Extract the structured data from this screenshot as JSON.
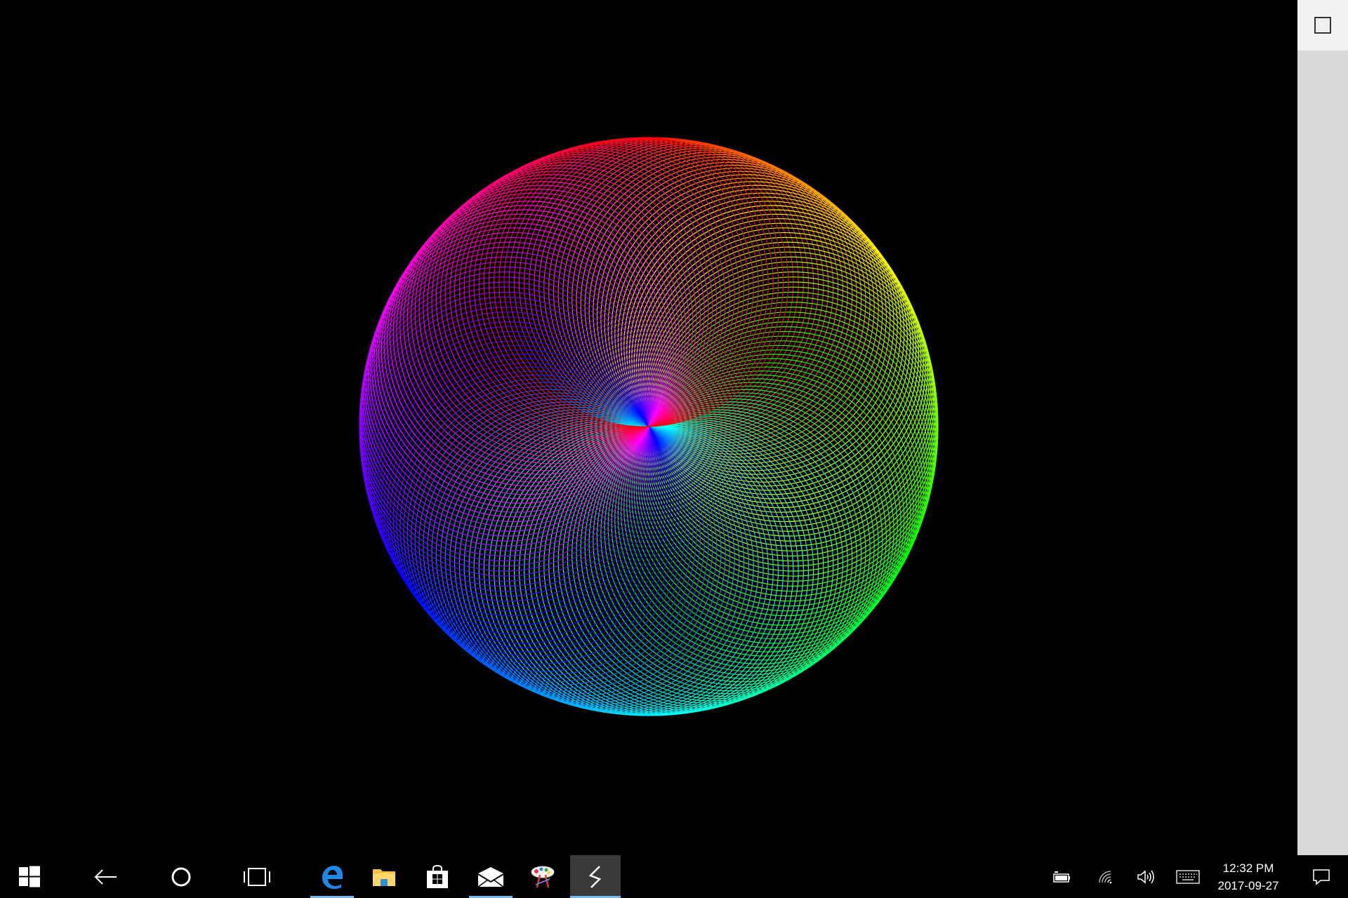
{
  "app": {
    "window_control": "maximize-icon"
  },
  "taskbar": {
    "start": "windows-logo-icon",
    "back": "back-arrow-icon",
    "cortana": "cortana-circle-icon",
    "task_view": "task-view-icon",
    "apps": [
      {
        "name": "edge",
        "icon": "edge-icon",
        "running": true
      },
      {
        "name": "file-explorer",
        "icon": "folder-icon",
        "running": false
      },
      {
        "name": "store",
        "icon": "store-bag-icon",
        "running": false
      },
      {
        "name": "mail",
        "icon": "mail-icon",
        "running": true
      },
      {
        "name": "paint",
        "icon": "paint-palette-icon",
        "running": false
      },
      {
        "name": "current-app",
        "icon": "lightning-app-icon",
        "running": true,
        "active": true
      }
    ],
    "tray": {
      "battery": "battery-icon",
      "network": "wifi-icon",
      "volume": "volume-icon",
      "keyboard": "touch-keyboard-icon",
      "notifications": "action-center-icon"
    },
    "clock": {
      "time": "12:32 PM",
      "date": "2017-09-27"
    }
  },
  "colors": {
    "accent": "#76b9ed",
    "panel_bg": "#d9d9d9"
  }
}
